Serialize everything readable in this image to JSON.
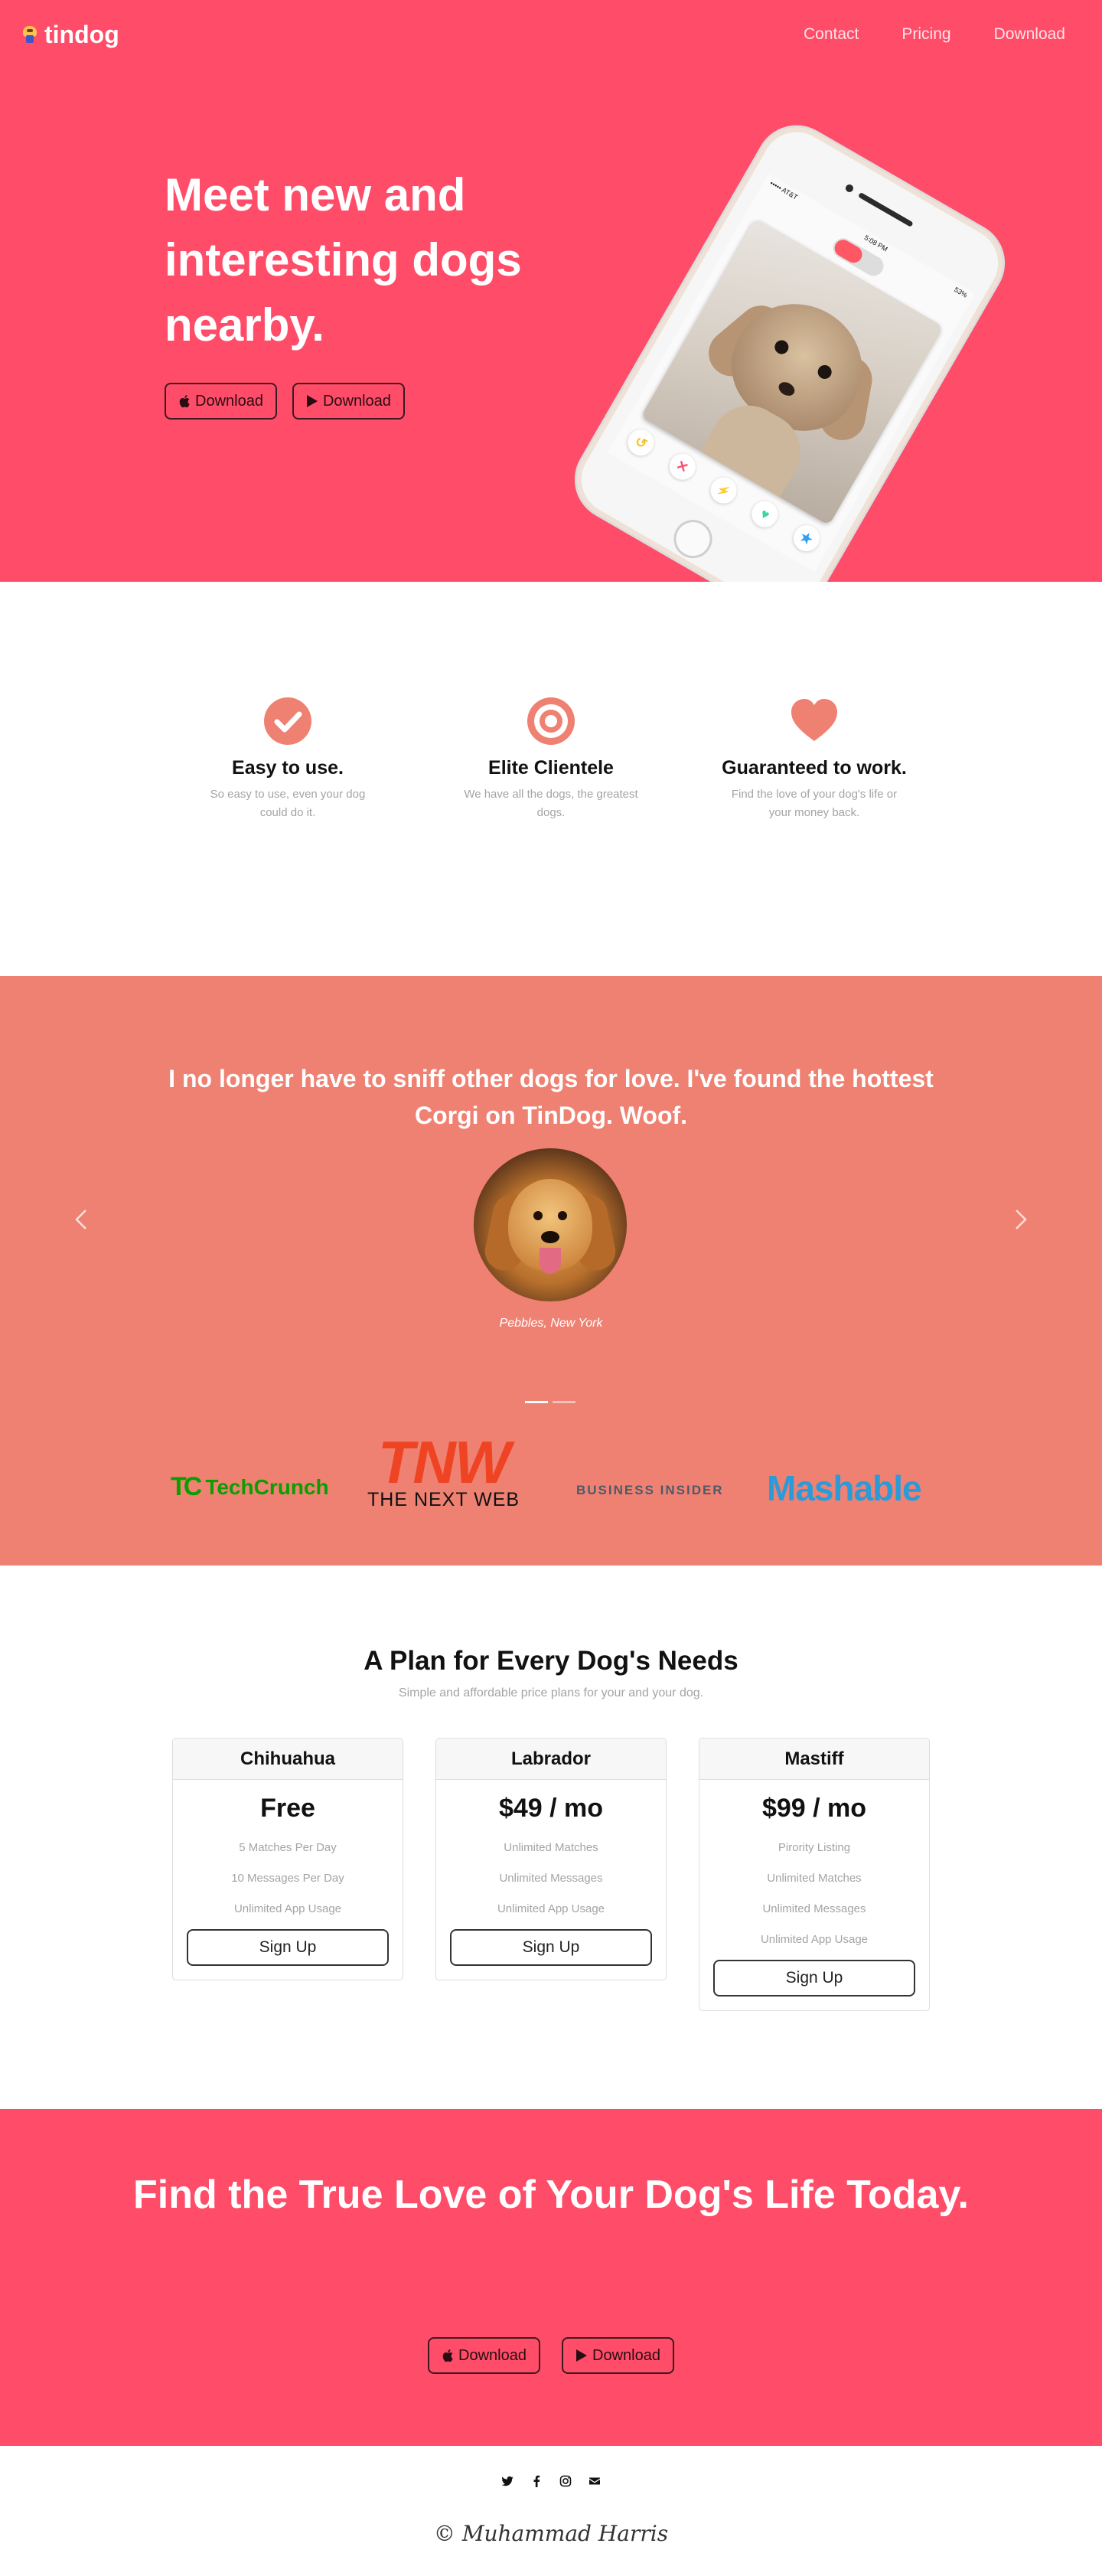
{
  "brand": {
    "name": "tindog",
    "logo_icon": "dog-logo-icon"
  },
  "nav": {
    "links": [
      "Contact",
      "Pricing",
      "Download"
    ]
  },
  "hero": {
    "title": "Meet new and interesting dogs nearby.",
    "download_apple": "Download",
    "download_google": "Download",
    "phone": {
      "carrier": "••••• AT&T",
      "time": "5:08 PM",
      "battery": "53%"
    }
  },
  "features": [
    {
      "icon": "check-circle-icon",
      "title": "Easy to use.",
      "text": "So easy to use, even your dog could do it."
    },
    {
      "icon": "bullseye-icon",
      "title": "Elite Clientele",
      "text": "We have all the dogs, the greatest dogs."
    },
    {
      "icon": "heart-icon",
      "title": "Guaranteed to work.",
      "text": "Find the love of your dog's life or your money back."
    }
  ],
  "testimonial": {
    "quote": "I no longer have to sniff other dogs for love. I've found the hottest Corgi on TinDog. Woof.",
    "caption": "Pebbles, New York",
    "active_slide": 1,
    "slide_count": 2
  },
  "press": {
    "techcrunch": {
      "mark": "TC",
      "name": "TechCrunch"
    },
    "tnw": {
      "mark": "TNW",
      "name": "THE NEXT WEB"
    },
    "business_insider": "BUSINESS INSIDER",
    "mashable": "Mashable"
  },
  "pricing": {
    "title": "A Plan for Every Dog's Needs",
    "subtitle": "Simple and affordable price plans for your and your dog.",
    "plans": [
      {
        "name": "Chihuahua",
        "price": "Free",
        "features": [
          "5 Matches Per Day",
          "10 Messages Per Day",
          "Unlimited App Usage"
        ],
        "cta": "Sign Up"
      },
      {
        "name": "Labrador",
        "price": "$49 / mo",
        "features": [
          "Unlimited Matches",
          "Unlimited Messages",
          "Unlimited App Usage"
        ],
        "cta": "Sign Up"
      },
      {
        "name": "Mastiff",
        "price": "$99 / mo",
        "features": [
          "Pirority Listing",
          "Unlimited Matches",
          "Unlimited Messages",
          "Unlimited App Usage"
        ],
        "cta": "Sign Up"
      }
    ]
  },
  "cta": {
    "title": "Find the True Love of Your Dog's Life Today.",
    "download_apple": "Download",
    "download_google": "Download"
  },
  "footer": {
    "social_icons": [
      "twitter-icon",
      "facebook-icon",
      "instagram-icon",
      "envelope-icon"
    ],
    "copyright": "© Muhammad Harris"
  },
  "colors": {
    "hero_bg": "#ff4c68",
    "testimonial_bg": "#ef8172",
    "feature_icon": "#ef8172",
    "techcrunch_green": "#0a9e01",
    "tnw_red": "#ef4423",
    "mashable_blue": "#2a9bd8"
  }
}
